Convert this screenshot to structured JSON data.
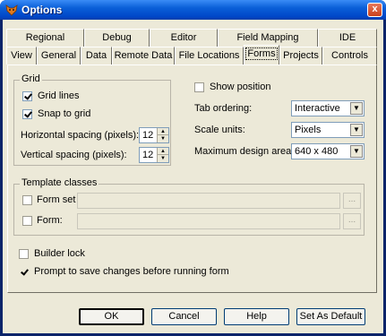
{
  "window": {
    "title": "Options",
    "icon": "fox-icon",
    "close": "x"
  },
  "tabs_row1": [
    "Regional",
    "Debug",
    "Editor",
    "Field Mapping",
    "IDE"
  ],
  "tabs_row2": [
    "View",
    "General",
    "Data",
    "Remote Data",
    "File Locations",
    "Forms",
    "Projects",
    "Controls"
  ],
  "active_tab": "Forms",
  "grid": {
    "title": "Grid",
    "grid_lines": "Grid lines",
    "snap_to_grid": "Snap to grid",
    "h_spacing_label": "Horizontal spacing (pixels):",
    "h_spacing_value": "12",
    "v_spacing_label": "Vertical spacing (pixels):",
    "v_spacing_value": "12"
  },
  "right": {
    "show_position": "Show position",
    "tab_ordering_label": "Tab ordering:",
    "tab_ordering_value": "Interactive",
    "scale_units_label": "Scale units:",
    "scale_units_value": "Pixels",
    "max_design_label": "Maximum design area:",
    "max_design_value": "640 x 480"
  },
  "template": {
    "title": "Template classes",
    "form_set": "Form set",
    "form": "Form:",
    "ellipsis": "..."
  },
  "options": {
    "builder_lock": "Builder lock",
    "prompt_save": "Prompt to save changes before running form"
  },
  "buttons": {
    "ok": "OK",
    "cancel": "Cancel",
    "help": "Help",
    "set_default": "Set As Default"
  },
  "colors": {
    "title_bar": "#0054e3",
    "dialog_bg": "#ece9d8",
    "close": "#c8411c"
  }
}
